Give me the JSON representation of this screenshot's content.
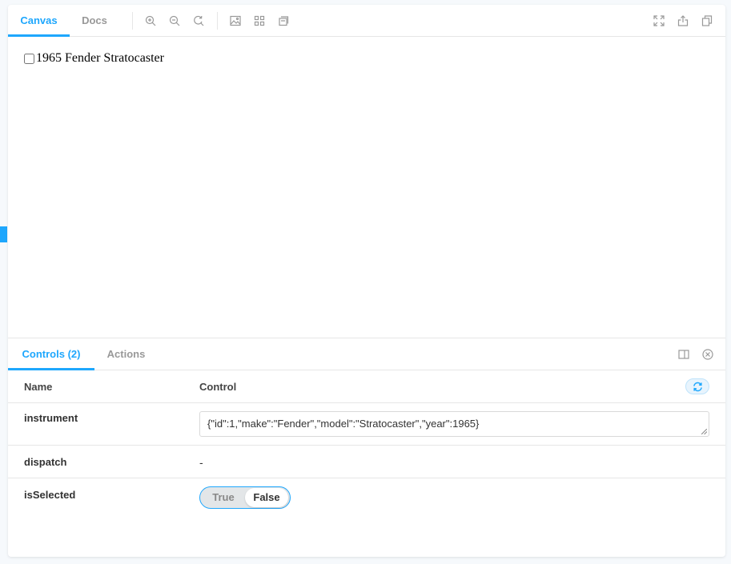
{
  "toolbar": {
    "tabs": [
      {
        "label": "Canvas",
        "active": true
      },
      {
        "label": "Docs",
        "active": false
      }
    ],
    "tools": [
      "zoom-in-icon",
      "zoom-out-icon",
      "zoom-reset-icon",
      "background-icon",
      "grid-icon",
      "outline-icon"
    ],
    "right_tools": [
      "fullscreen-icon",
      "share-icon",
      "copy-link-icon"
    ]
  },
  "canvas": {
    "story_label": "1965 Fender Stratocaster",
    "checkbox_checked": false
  },
  "addons": {
    "tabs": [
      {
        "label": "Controls (2)",
        "active": true
      },
      {
        "label": "Actions",
        "active": false
      }
    ],
    "right_tools": [
      "panel-orientation-icon",
      "close-panel-icon"
    ],
    "table": {
      "headers": {
        "name": "Name",
        "control": "Control"
      },
      "rows": [
        {
          "name": "instrument",
          "value": "{\"id\":1,\"make\":\"Fender\",\"model\":\"Stratocaster\",\"year\":1965}"
        },
        {
          "name": "dispatch",
          "value": "-"
        },
        {
          "name": "isSelected",
          "true_label": "True",
          "false_label": "False",
          "selected": "False"
        }
      ]
    }
  },
  "colors": {
    "accent": "#1ea7fd",
    "muted": "#999999",
    "border": "#e6e6e6",
    "background": "#f6f9fc"
  }
}
